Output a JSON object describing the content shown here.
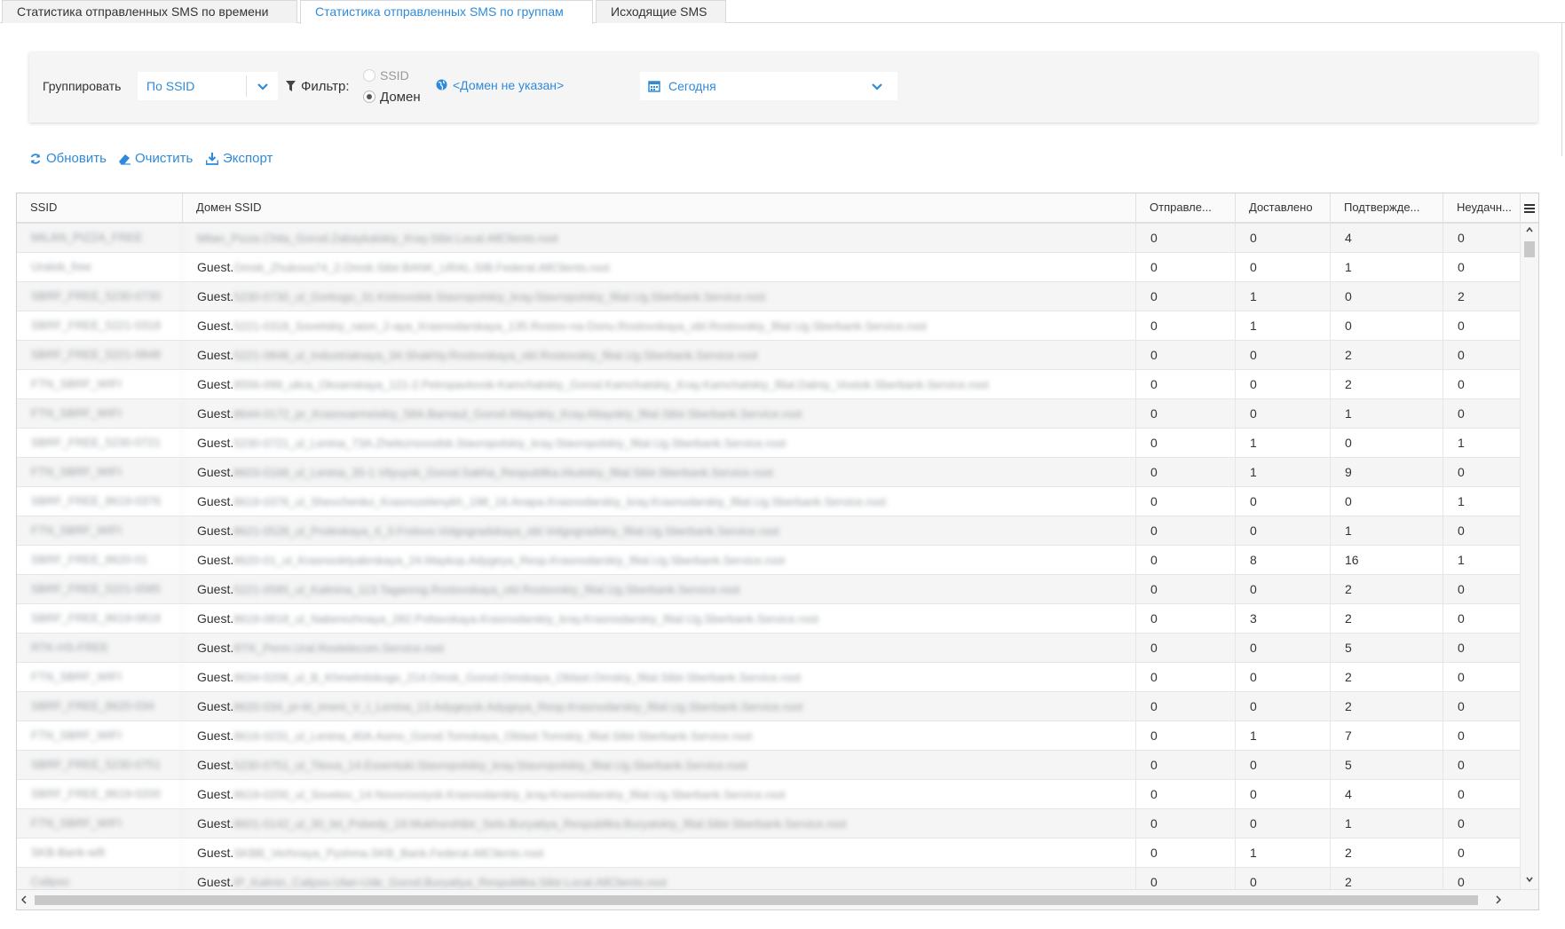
{
  "tabs": [
    {
      "label": "Статистика отправленных SMS по времени",
      "active": false
    },
    {
      "label": "Статистика отправленных SMS по группам",
      "active": true
    },
    {
      "label": "Исходящие SMS",
      "active": false
    }
  ],
  "filters": {
    "group_label": "Группировать",
    "group_value": "По SSID",
    "filter_label": "Фильтр:",
    "radio_ssid": "SSID",
    "radio_domain": "Домен",
    "selected_radio": "Домен",
    "domain_link": "<Домен не указан>",
    "date_value": "Сегодня"
  },
  "toolbar": {
    "refresh": "Обновить",
    "clear": "Очистить",
    "export": "Экспорт"
  },
  "grid": {
    "columns": [
      "SSID",
      "Домен SSID",
      "Отправле...",
      "Доставлено",
      "Подтвержде...",
      "Неудачн..."
    ],
    "rows": [
      {
        "ssid": "MILAN_PIZZA_FREE",
        "domain": "Milan_Pizza.Chita_Gorod.Zabaykalskiy_Kray.Sibir.Local.AllClients.root",
        "sent": "0",
        "delivered": "0",
        "confirmed": "4",
        "failed": "0"
      },
      {
        "ssid": "Uralob_free",
        "domain": "Guest.Omsk_Zhukova74_2.Omsk.Sibir.BANK_URAL.SIB.Federal.AllClients.root",
        "sent": "0",
        "delivered": "0",
        "confirmed": "1",
        "failed": "0"
      },
      {
        "ssid": "SBRF_FREE_5230-0730",
        "domain": "Guest.5230-0730_ul_Gorkogo_31.Kislovodsk.Stavropolskiy_kray.Stavropolskiy_filial.Ug.Sberbank.Service.root",
        "sent": "0",
        "delivered": "1",
        "confirmed": "0",
        "failed": "2"
      },
      {
        "ssid": "SBRF_FREE_5221-0318",
        "domain": "Guest.5221-0318_Sovetskiy_raion_2-aya_Krasnodarskaya_135.Rostov-na-Donu.Rostovskaya_obl.Rostovskiy_filial.Ug.Sberbank.Service.root",
        "sent": "0",
        "delivered": "1",
        "confirmed": "0",
        "failed": "0"
      },
      {
        "ssid": "SBRF_FREE_5221-0848",
        "domain": "Guest.5221-0848_ul_Industrialnaya_34.Shakhty.Rostovskaya_obl.Rostovskiy_filial.Ug.Sberbank.Service.root",
        "sent": "0",
        "delivered": "0",
        "confirmed": "2",
        "failed": "0"
      },
      {
        "ssid": "FTN_SBRF_WIFI",
        "domain": "Guest.8556-099_ulica_Oksanskaya_121-2.Petropavlovsk-Kamchatskiy_Gorod.Kamchatskiy_Kray.Kamchatskiy_filial.Dalniy_Vostok.Sberbank.Service.root",
        "sent": "0",
        "delivered": "0",
        "confirmed": "2",
        "failed": "0"
      },
      {
        "ssid": "FTN_SBRF_WIFI",
        "domain": "Guest.8644-0172_pr_Krasnoarmeiskiy_58A.Barnaul_Gorod.Altayskiy_Kray.Altayskiy_filial.Sibir.Sberbank.Service.root",
        "sent": "0",
        "delivered": "0",
        "confirmed": "1",
        "failed": "0"
      },
      {
        "ssid": "SBRF_FREE_5230-0721",
        "domain": "Guest.5230-0721_ul_Lenina_73A.Zheleznovodsk.Stavropolskiy_kray.Stavropolskiy_filial.Ug.Sberbank.Service.root",
        "sent": "0",
        "delivered": "1",
        "confirmed": "0",
        "failed": "1"
      },
      {
        "ssid": "FTN_SBRF_WIFI",
        "domain": "Guest.8603-0168_ul_Lenina_35-1.Vilyuysk_Gorod.Sakha_Respublika.Irkutskiy_filial.Sibir.Sberbank.Service.root",
        "sent": "0",
        "delivered": "1",
        "confirmed": "9",
        "failed": "0"
      },
      {
        "ssid": "SBRF_FREE_8619-0376",
        "domain": "Guest.8619-0376_ul_Shevchenko_Krasnozelenykh_198_16.Anapa.Krasnodarskiy_kray.Krasnodarskiy_filial.Ug.Sberbank.Service.root",
        "sent": "0",
        "delivered": "0",
        "confirmed": "0",
        "failed": "1"
      },
      {
        "ssid": "FTN_SBRF_WIFI",
        "domain": "Guest.8621-0528_ul_Proleskaya_4_3.Frolovo.Volgogradskaya_obl.Volgogradskiy_filial.Ug.Sberbank.Service.root",
        "sent": "0",
        "delivered": "0",
        "confirmed": "1",
        "failed": "0"
      },
      {
        "ssid": "SBRF_FREE_8620-01",
        "domain": "Guest.8620-01_ul_Krasnooktyabrskaya_24.Maykop.Adygeya_Resp.Krasnodarskiy_filial.Ug.Sberbank.Service.root",
        "sent": "0",
        "delivered": "8",
        "confirmed": "16",
        "failed": "1"
      },
      {
        "ssid": "SBRF_FREE_5221-0585",
        "domain": "Guest.5221-0585_ul_Kalinina_113.Taganrog.Rostovskaya_obl.Rostovskiy_filial.Ug.Sberbank.Service.root",
        "sent": "0",
        "delivered": "0",
        "confirmed": "2",
        "failed": "0"
      },
      {
        "ssid": "SBRF_FREE_8619-0818",
        "domain": "Guest.8619-0818_ul_Naberezhnaya_282.Poltavskaya.Krasnodarskiy_kray.Krasnodarskiy_filial.Ug.Sberbank.Service.root",
        "sent": "0",
        "delivered": "3",
        "confirmed": "2",
        "failed": "0"
      },
      {
        "ssid": "RTK-HS-FREE",
        "domain": "Guest.RTK_Perm.Ural.Rostelecom.Service.root",
        "sent": "0",
        "delivered": "0",
        "confirmed": "5",
        "failed": "0"
      },
      {
        "ssid": "FTN_SBRF_WIFI",
        "domain": "Guest.8634-0206_ul_B_Khmelnitskogo_214.Omsk_Gorod.Omskaya_Oblast.Omskiy_filial.Sibir.Sberbank.Service.root",
        "sent": "0",
        "delivered": "0",
        "confirmed": "2",
        "failed": "0"
      },
      {
        "ssid": "SBRF_FREE_8620-034",
        "domain": "Guest.8620-034_pr-kt_imeni_V_I_Lenina_13.Adygeysk.Adygeya_Resp.Krasnodarskiy_filial.Ug.Sberbank.Service.root",
        "sent": "0",
        "delivered": "0",
        "confirmed": "2",
        "failed": "0"
      },
      {
        "ssid": "FTN_SBRF_WIFI",
        "domain": "Guest.8616-0231_ul_Lenina_40A.Asino_Gorod.Tomskaya_Oblast.Tomskiy_filial.Sibir.Sberbank.Service.root",
        "sent": "0",
        "delivered": "1",
        "confirmed": "7",
        "failed": "0"
      },
      {
        "ssid": "SBRF_FREE_5230-0751",
        "domain": "Guest.5230-0751_ul_Titova_14.Essentuki.Stavropolskiy_kray.Stavropolskiy_filial.Ug.Sberbank.Service.root",
        "sent": "0",
        "delivered": "0",
        "confirmed": "5",
        "failed": "0"
      },
      {
        "ssid": "SBRF_FREE_8619-0200",
        "domain": "Guest.8619-0200_ul_Sovetov_14.Novorossiysk.Krasnodarskiy_kray.Krasnodarskiy_filial.Ug.Sberbank.Service.root",
        "sent": "0",
        "delivered": "0",
        "confirmed": "4",
        "failed": "0"
      },
      {
        "ssid": "FTN_SBRF_WIFI",
        "domain": "Guest.8601-0142_ul_30_let_Pobedy_19.Mukhorshibir_Selo.Buryatiya_Respublika.Buryatskiy_filial.Sibir.Sberbank.Service.root",
        "sent": "0",
        "delivered": "0",
        "confirmed": "1",
        "failed": "0"
      },
      {
        "ssid": "SKB-Bank-wifi",
        "domain": "Guest.SKBB_Verhnaya_Pyshma.SKB_Bank.Federal.AllClients.root",
        "sent": "0",
        "delivered": "1",
        "confirmed": "2",
        "failed": "0"
      },
      {
        "ssid": "Calipso",
        "domain": "Guest.IP_Kalinin_Calipso.Ulan-Ude_Gorod.Buryatiya_Respublika.Sibir.Local.AllClients.root",
        "sent": "0",
        "delivered": "0",
        "confirmed": "2",
        "failed": "0"
      }
    ]
  }
}
